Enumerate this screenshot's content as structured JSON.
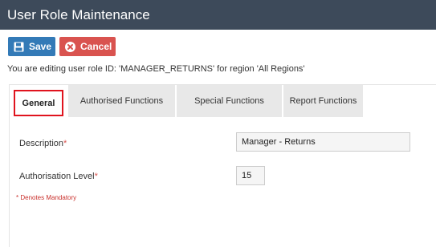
{
  "window": {
    "title": "User Role Maintenance"
  },
  "toolbar": {
    "save_label": "Save",
    "save_icon": "floppy-disk-icon",
    "cancel_label": "Cancel",
    "cancel_icon": "close-circle-icon"
  },
  "info": {
    "text": "You are editing user role ID: 'MANAGER_RETURNS' for region 'All Regions'"
  },
  "tabs": [
    {
      "label": "General",
      "active": true
    },
    {
      "label": "Authorised Functions",
      "active": false
    },
    {
      "label": "Special Functions",
      "active": false
    },
    {
      "label": "Report Functions",
      "active": false
    }
  ],
  "form": {
    "description_label": "Description",
    "description_value": "Manager - Returns",
    "auth_level_label": "Authorisation Level",
    "auth_level_value": "15",
    "required_marker": "*",
    "mandatory_note": "* Denotes Mandatory"
  },
  "colors": {
    "titlebar": "#3d4a5a",
    "save": "#337ab7",
    "cancel": "#d9534f",
    "active_tab_border": "#e0141e"
  }
}
